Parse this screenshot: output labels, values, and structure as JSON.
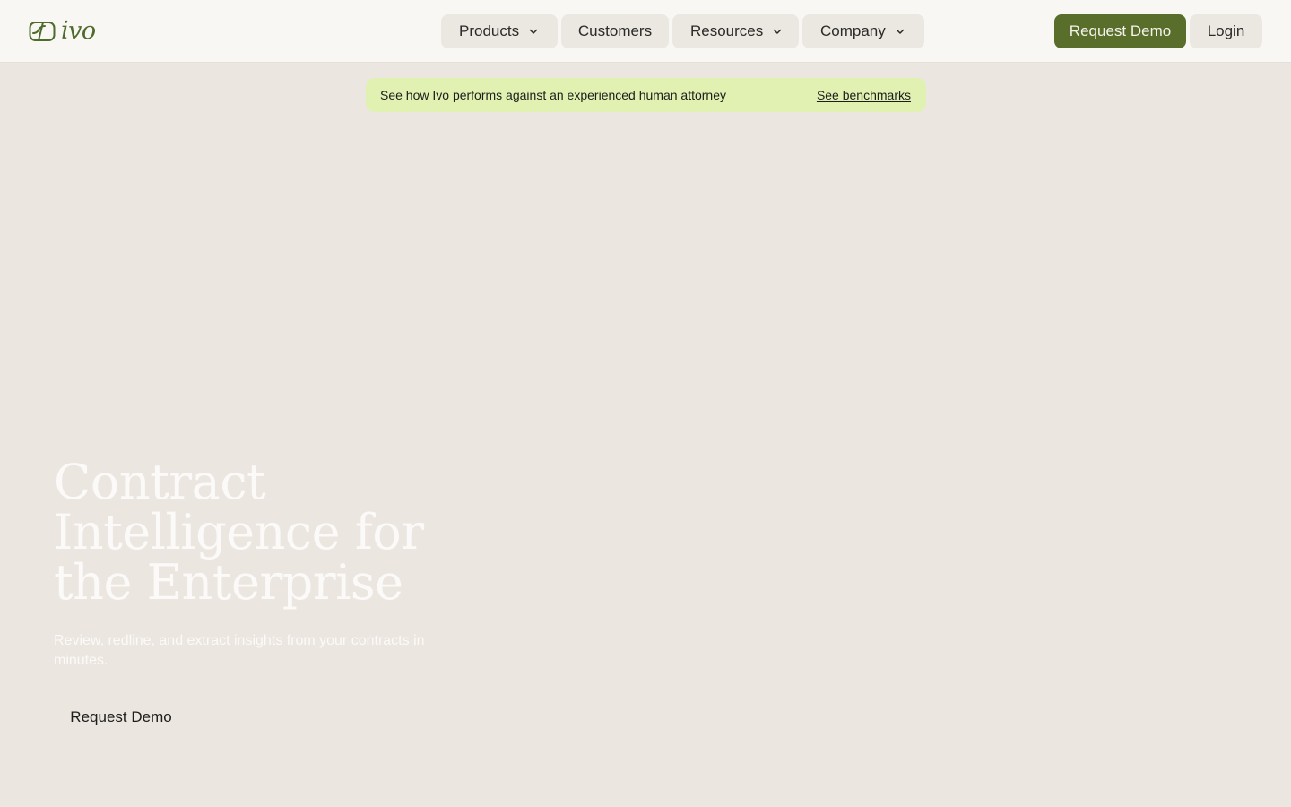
{
  "brand": {
    "name": "ivo",
    "color": "#4f6b2b"
  },
  "nav": {
    "items": [
      {
        "label": "Products",
        "has_dropdown": true,
        "icon": "chevron-down-icon"
      },
      {
        "label": "Customers",
        "has_dropdown": false
      },
      {
        "label": "Resources",
        "has_dropdown": true,
        "icon": "chevron-down-icon"
      },
      {
        "label": "Company",
        "has_dropdown": true,
        "icon": "chevron-down-icon"
      }
    ]
  },
  "header_actions": {
    "request_demo_label": "Request Demo",
    "login_label": "Login",
    "accent_color": "#5a6e2c"
  },
  "announcement": {
    "text": "See how Ivo performs against an experienced human attorney",
    "link_label": "See benchmarks",
    "background_color": "#e0f1b2"
  },
  "hero": {
    "title": "Contract Intelligence for the Enterprise",
    "subtitle": "Review, redline, and extract insights from your contracts in minutes.",
    "cta_label": "Request Demo"
  },
  "colors": {
    "page_background": "#ebe6e0",
    "header_background": "#f8f7f4",
    "nav_pill": "#ebe7e1"
  }
}
